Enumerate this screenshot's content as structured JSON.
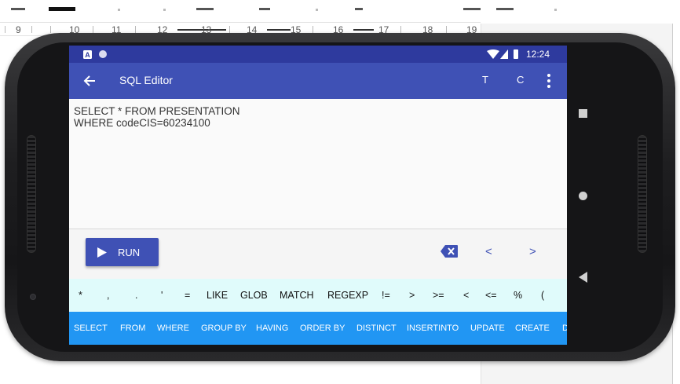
{
  "ruler": {
    "numbers": [
      "9",
      "10",
      "11",
      "12",
      "13",
      "14",
      "15",
      "16",
      "17",
      "18",
      "19"
    ]
  },
  "status_bar": {
    "time": "12:24"
  },
  "app_bar": {
    "title": "SQL Editor",
    "action_t": "T",
    "action_c": "C"
  },
  "editor": {
    "text": "SELECT * FROM PRESENTATION\nWHERE codeCIS=60234100"
  },
  "actions": {
    "run_label": "RUN",
    "prev_label": "<",
    "next_label": ">"
  },
  "symbol_keys": [
    "*",
    ",",
    ".",
    "'",
    "=",
    "LIKE",
    "GLOB",
    "MATCH",
    "REGEXP",
    "!=",
    ">",
    ">=",
    "<",
    "<=",
    "%",
    "("
  ],
  "keyword_keys": [
    "SELECT",
    "FROM",
    "WHERE",
    "GROUP BY",
    "HAVING",
    "ORDER BY",
    "DISTINCT",
    "INSERTINTO",
    "UPDATE",
    "CREATE",
    "D"
  ],
  "colors": {
    "status_bar": "#2e3a9e",
    "app_bar": "#3f51b5",
    "symbol_row": "#e0fbfb",
    "keyword_row": "#2196f3"
  }
}
